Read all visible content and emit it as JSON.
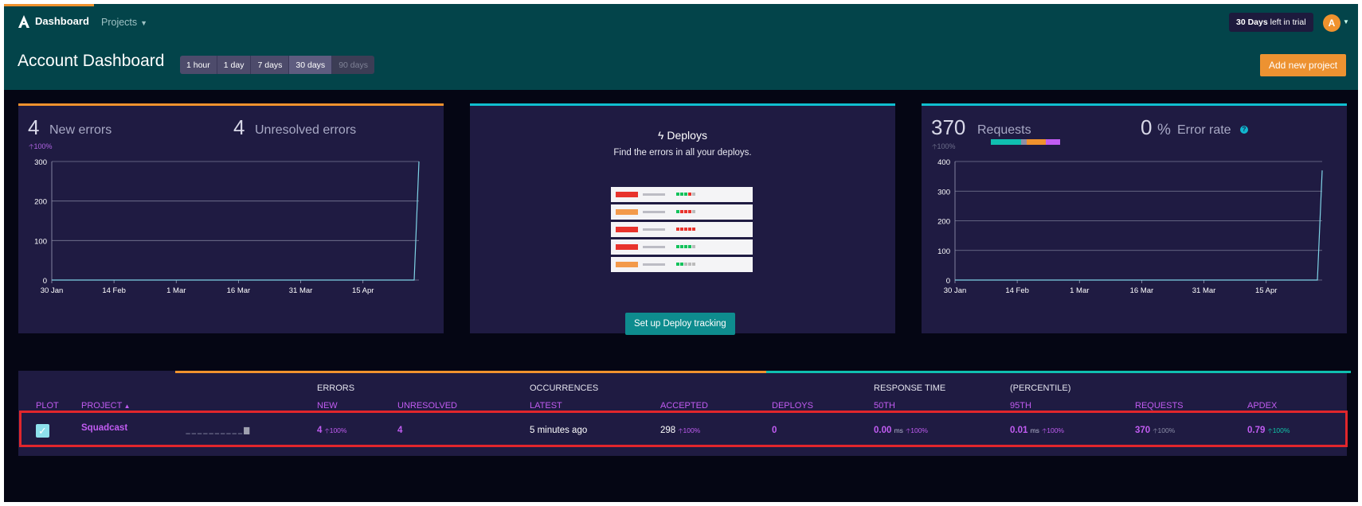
{
  "header": {
    "brand_label": "Dashboard",
    "projects_label": "Projects",
    "trial": {
      "days": "30 Days",
      "suffix": "left in trial"
    },
    "avatar_letter": "A",
    "page_title": "Account Dashboard",
    "time_ranges": [
      {
        "label": "1 hour",
        "state": "normal"
      },
      {
        "label": "1 day",
        "state": "normal"
      },
      {
        "label": "7 days",
        "state": "normal"
      },
      {
        "label": "30 days",
        "state": "active"
      },
      {
        "label": "90 days",
        "state": "disabled"
      }
    ],
    "add_project_label": "Add new project"
  },
  "errors_panel": {
    "new_count": "4",
    "new_label": "New errors",
    "new_pct": "100%",
    "unresolved_count": "4",
    "unresolved_label": "Unresolved errors"
  },
  "deploys_panel": {
    "title": "Deploys",
    "subtitle": "Find the errors in all your deploys.",
    "button_label": "Set up Deploy tracking"
  },
  "requests_panel": {
    "requests_count": "370",
    "requests_label": "Requests",
    "requests_pct": "100%",
    "error_rate_value": "0",
    "error_rate_unit": "%",
    "error_rate_label": "Error rate"
  },
  "chart_data": [
    {
      "type": "line",
      "x": [
        "30 Jan",
        "14 Feb",
        "1 Mar",
        "16 Mar",
        "31 Mar",
        "15 Apr"
      ],
      "ylim": [
        0,
        300
      ],
      "yticks": [
        0,
        100,
        200,
        300
      ],
      "series": [
        {
          "values": [
            0,
            0,
            0,
            0,
            0,
            0,
            300
          ]
        }
      ]
    },
    {
      "type": "line",
      "x": [
        "30 Jan",
        "14 Feb",
        "1 Mar",
        "16 Mar",
        "31 Mar",
        "15 Apr"
      ],
      "ylim": [
        0,
        400
      ],
      "yticks": [
        0,
        100,
        200,
        300,
        400
      ],
      "series": [
        {
          "values": [
            0,
            0,
            0,
            0,
            0,
            0,
            370
          ]
        }
      ]
    }
  ],
  "colors": {
    "orange": "#f0922e",
    "teal": "#10bfd0",
    "purple": "#c15cf2",
    "panel": "#1f1b42"
  },
  "table": {
    "group_headers": {
      "errors": "ERRORS",
      "occurrences": "OCCURRENCES",
      "response_time": "RESPONSE TIME",
      "percentile": "(PERCENTILE)"
    },
    "columns": {
      "plot": "PLOT",
      "project": "PROJECT",
      "new": "NEW",
      "unresolved": "UNRESOLVED",
      "latest": "LATEST",
      "accepted": "ACCEPTED",
      "deploys": "DEPLOYS",
      "p50": "50TH",
      "p95": "95TH",
      "requests": "REQUESTS",
      "apdex": "APDEX"
    },
    "row": {
      "project": "Squadcast",
      "new": "4",
      "new_pct": "100%",
      "unresolved": "4",
      "latest": "5 minutes ago",
      "accepted": "298",
      "accepted_pct": "100%",
      "deploys": "0",
      "p50": "0.00",
      "p50_unit": "ms",
      "p50_pct": "100%",
      "p95": "0.01",
      "p95_unit": "ms",
      "p95_pct": "100%",
      "requests": "370",
      "requests_pct": "100%",
      "apdex": "0.79",
      "apdex_pct": "100%"
    }
  }
}
